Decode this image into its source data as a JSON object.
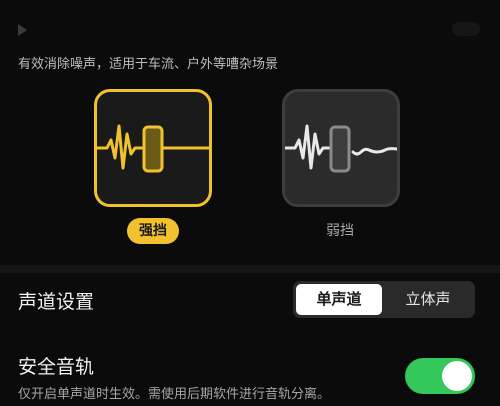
{
  "description": "有效消除噪声，适用于车流、户外等嘈杂场景",
  "modes": [
    {
      "label": "强挡",
      "selected": true,
      "accent_color": "#f2c12e"
    },
    {
      "label": "弱挡",
      "selected": false
    }
  ],
  "channel": {
    "title": "声道设置",
    "options": [
      "单声道",
      "立体声"
    ],
    "selected": "单声道"
  },
  "safe_track": {
    "title": "安全音轨",
    "note": "仅开启单声道时生效。需使用后期软件进行音轨分离。",
    "enabled": true,
    "toggle_color": "#34c759"
  },
  "icons": [
    "play-icon",
    "strong-waveform-icon",
    "weak-waveform-icon"
  ]
}
